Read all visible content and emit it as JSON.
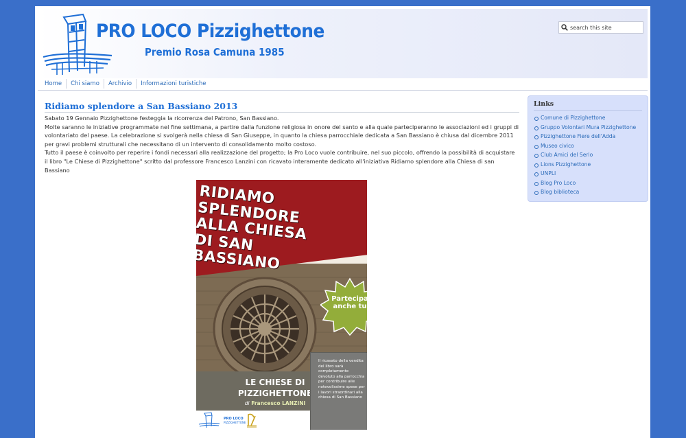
{
  "header": {
    "title": "PRO LOCO Pizzighettone",
    "subtitle": "Premio Rosa Camuna 1985",
    "search_placeholder": "search this site"
  },
  "nav": {
    "items": [
      "Home",
      "Chi siamo",
      "Archivio",
      "Informazioni turistiche"
    ]
  },
  "article": {
    "title": "Ridiamo splendore a San Bassiano 2013",
    "paragraphs": [
      "Sabato 19 Gennaio Pizzighettone festeggia la ricorrenza del Patrono, San Bassiano.",
      "Molte saranno le iniziative programmate nel fine settimana, a partire dalla funzione religiosa in onore del santo e alla quale parteciperanno le associazioni ed i gruppi di volontariato del paese. La celebrazione si svolgerà nella chiesa di San Giuseppe, in quanto la chiesa parrocchiale dedicata a San Bassiano è chiusa dal dicembre 2011 per gravi problemi strutturali che necessitano di un intervento di consolidamento molto costoso.",
      "Tutto il paese è coinvolto per reperire i fondi necessari alla realizzazione del progetto; la Pro Loco vuole contribuire, nel suo piccolo, offrendo la possibilità di acquistare il libro \"Le Chiese di Pizzighettone\" scritto dal professore Francesco Lanzini con ricavato interamente dedicato all'iniziativa Ridiamo splendore alla Chiesa di san Bassiano"
    ]
  },
  "poster": {
    "heading_lines": [
      "RIDIAMO",
      "SPLENDORE",
      "ALLA CHIESA",
      "DI SAN",
      "BASSIANO"
    ],
    "badge_lines": [
      "Partecipa",
      "anche tu"
    ],
    "book_title_lines": [
      "LE CHIESE DI",
      "PIZZIGHETTONE"
    ],
    "author_prefix": "di",
    "author": "Francesco LANZINI",
    "note": "Il ricavato della vendita del libro sarà completamente devoluto alla parrocchia per contribuire alle notevolissime spese per i lavori straordinari alla chiesa di San Bassiano",
    "colors": {
      "red": "#9d1b1f",
      "green": "#93ad3a",
      "gray": "#6e6b60"
    }
  },
  "sidebar": {
    "title": "Links",
    "items": [
      "Comune di Pizzighettone",
      "Gruppo Volontari Mura Pizzighettone",
      "Pizzighettone Fiere dell'Adda",
      "Museo civico",
      "Club Amici del Serio",
      "Lions Pizzighettone",
      "UNPLI",
      "Blog Pro Loco",
      "Blog biblioteca"
    ]
  },
  "icons": {
    "search": "search-icon",
    "logo": "tower-logo-icon"
  },
  "colors": {
    "background": "#3a6fc9",
    "accent": "#1f6fd6",
    "link": "#2a6ab8",
    "sidebar_bg": "#d7e0fb"
  }
}
